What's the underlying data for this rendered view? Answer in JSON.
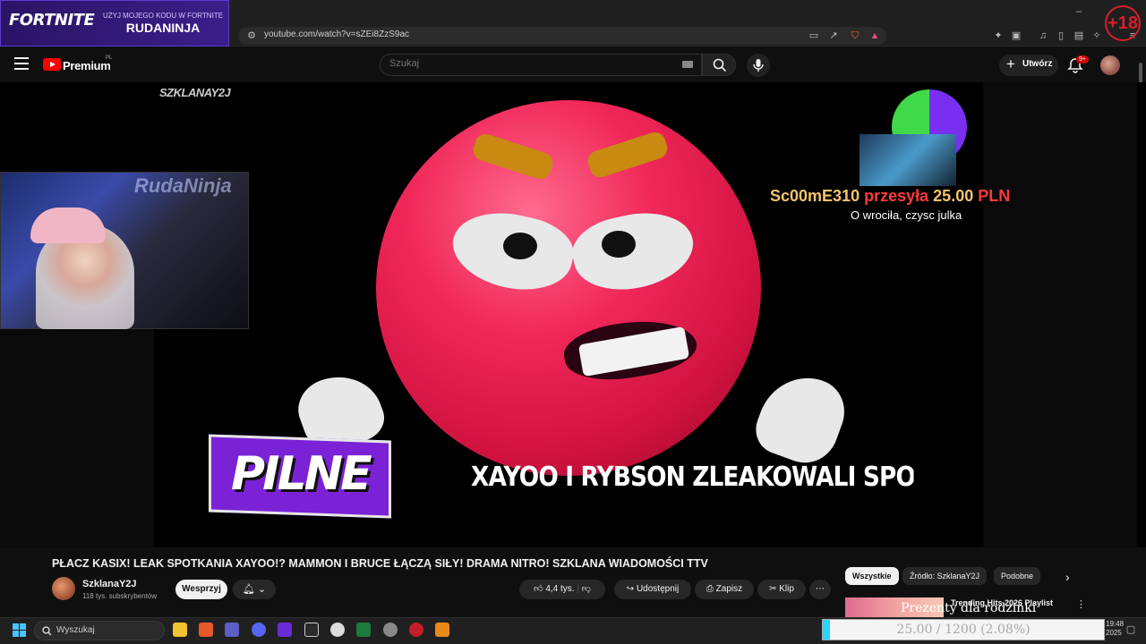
{
  "browser": {
    "url": "youtube.com/watch?v=sZEi8ZzS9ac"
  },
  "overlay": {
    "fortnite_logo": "FORTNITE",
    "fortnite_sub": "UŻYJ MOJEGO KODU W FORTNITE",
    "fortnite_code": "RUDANINJA",
    "age_badge": "+18"
  },
  "header": {
    "brand": "Premium",
    "region": "PL",
    "search_placeholder": "Szukaj",
    "create_label": "Utwórz",
    "notifications_badge": "9+"
  },
  "video": {
    "watermark": "SZKLANAY2J",
    "webcam_text": "RudaNinja",
    "pilne_label": "PILNE",
    "ticker_text": "XAYOO I RYBSON ZLEAKOWALI SPOTKANIE (",
    "donation": {
      "name": "Sc00mE310",
      "verb": "przesyła",
      "amount": "25.00",
      "currency": "PLN",
      "message": "O wrociła, czysc julka"
    }
  },
  "info": {
    "title": "PŁACZ KASIX! LEAK SPOTKANIA XAYOO!? MAMMON I BRUCE ŁĄCZĄ SIŁY! DRAMA NITRO! SZKLANA WIADOMOŚCI TTV",
    "channel_name": "SzklanaY2J",
    "subscribers": "118 tys. subskrybentów",
    "support_label": "Wesprzyj",
    "likes": "4,4 tys.",
    "share_label": "Udostępnij",
    "save_label": "Zapisz",
    "clip_label": "Klip"
  },
  "chips": {
    "all": "Wszystkie",
    "source": "Źródło: SzklanaY2J",
    "similar": "Podobne"
  },
  "recommendation": {
    "thumb_text": "Prezenty dla rodzinki",
    "title": "Trending Hits 2026 Playlist"
  },
  "taskbar": {
    "search_placeholder": "Wyszukaj",
    "goal_text": "25.00 / 1200 (2.08%)",
    "goal_fraction": 0.0208,
    "time": "19:48",
    "year": "2025"
  }
}
